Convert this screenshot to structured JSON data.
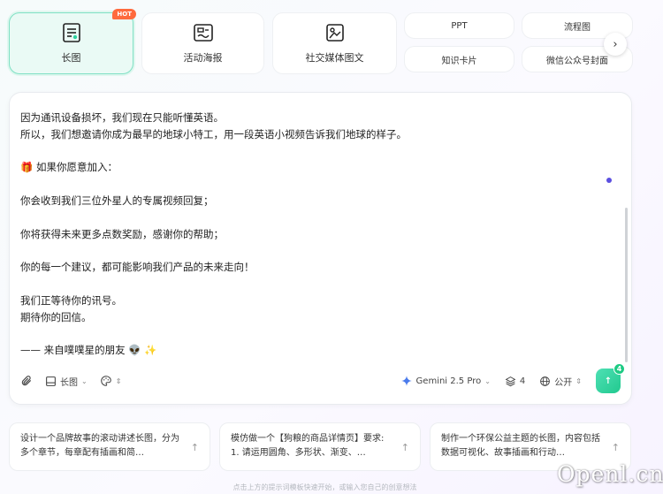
{
  "templates": {
    "hot_badge": "HOT",
    "big": [
      {
        "label": "长图",
        "icon": "long-image-icon"
      },
      {
        "label": "活动海报",
        "icon": "poster-icon"
      },
      {
        "label": "社交媒体图文",
        "icon": "social-media-icon"
      }
    ],
    "small": [
      {
        "label": "PPT"
      },
      {
        "label": "流程图"
      },
      {
        "label": "知识卡片"
      },
      {
        "label": "微信公众号封面"
      }
    ],
    "next_icon": "chevron-right-icon"
  },
  "editor": {
    "lines": [
      "因为通讯设备损坏，我们现在只能听懂英语。",
      "所以，我们想邀请你成为最早的地球小特工，用一段英语小视频告诉我们地球的样子。",
      "",
      "🎁  如果你愿意加入：",
      "",
      "你会收到我们三位外星人的专属视频回复；",
      "",
      "你将获得未来更多点数奖励，感谢你的帮助；",
      "",
      "你的每一个建议，都可能影响我们产品的未来走向！",
      "",
      "我们正等待你的讯号。",
      "期待你的回信。",
      "",
      "—— 来自噗噗星的朋友 👽 ✨"
    ],
    "toolbar": {
      "format_label": "长图",
      "model_label": "Gemini 2.5 Pro",
      "count_label": "4",
      "visibility_label": "公开",
      "send_badge": "4"
    }
  },
  "suggestions": [
    {
      "text": "设计一个品牌故事的滚动讲述长图，分为多个章节，每章配有插画和简…"
    },
    {
      "text": "模仿做一个【狗粮的商品详情页】要求: 1. 请运用圆角、多形状、渐变、…"
    },
    {
      "text": "制作一个环保公益主题的长图，内容包括数据可视化、故事插画和行动…"
    }
  ],
  "hint": "点击上方的提示词模板快速开始，或输入您自己的创意想法",
  "watermark": "Openl.cn",
  "colors": {
    "accent": "#22c98f",
    "hot": "#ff6a3d",
    "dot": "#5b4fe0"
  }
}
